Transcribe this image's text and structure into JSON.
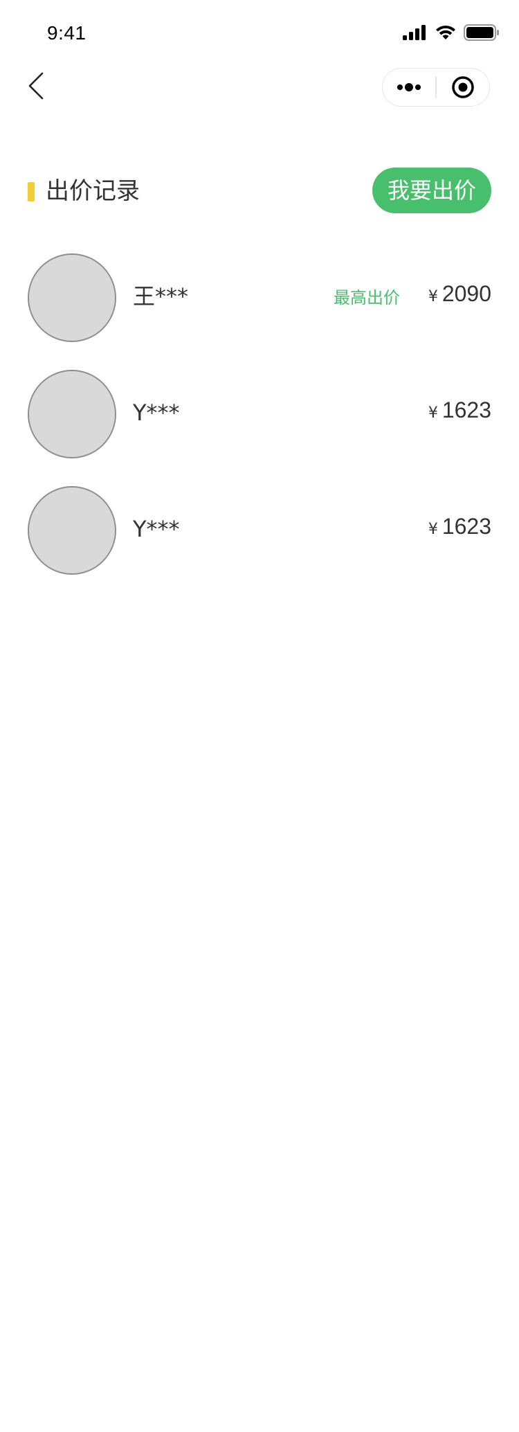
{
  "status_bar": {
    "time": "9:41",
    "icons": [
      "signal-icon",
      "wifi-icon",
      "battery-icon"
    ]
  },
  "nav": {
    "back_icon": "chevron-left-icon",
    "capsule_icons": [
      "more-dots-icon",
      "close-target-icon"
    ]
  },
  "section": {
    "title": "出价记录",
    "bar_color": "#f3cd38",
    "bid_button_label": "我要出价",
    "bid_button_color": "#48bf6c"
  },
  "bids": [
    {
      "name": "王***",
      "tag": "最高出价",
      "currency": "¥",
      "amount": "2090"
    },
    {
      "name": "Y***",
      "tag": "",
      "currency": "¥",
      "amount": "1623"
    },
    {
      "name": "Y***",
      "tag": "",
      "currency": "¥",
      "amount": "1623"
    }
  ],
  "colors": {
    "accent_green": "#48bf6c",
    "avatar_fill": "#d9d9d9",
    "text_primary": "#333333"
  }
}
